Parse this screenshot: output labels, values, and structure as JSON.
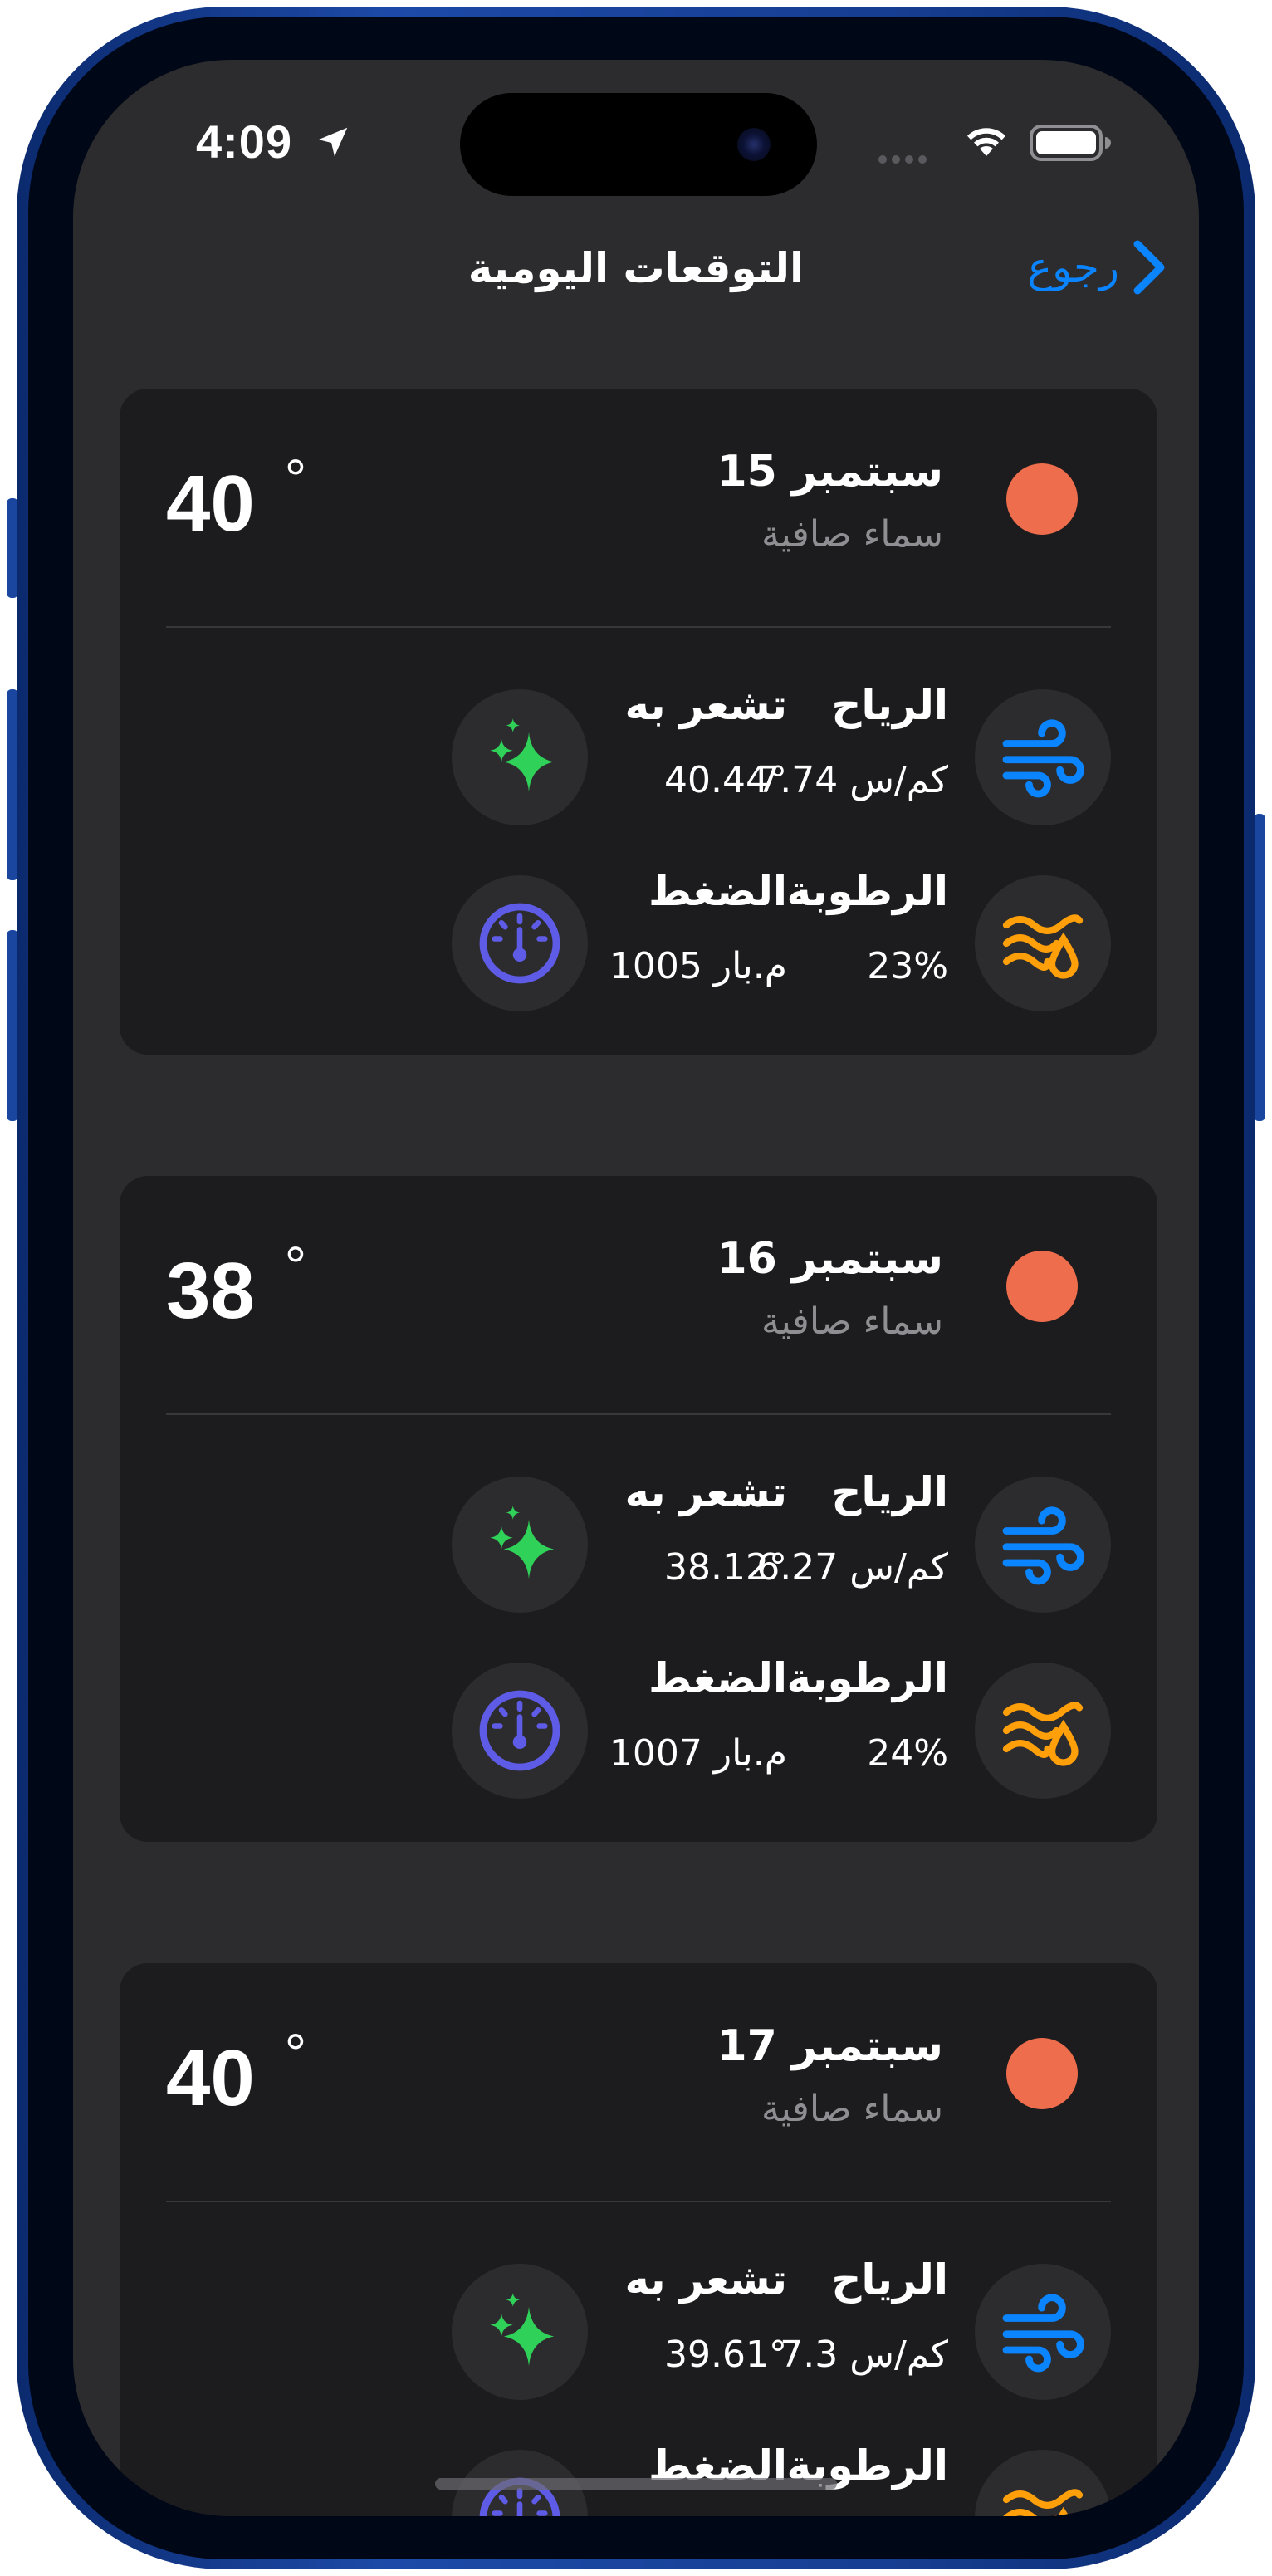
{
  "status_bar": {
    "time": "4:09",
    "location_icon": "location-arrow-icon",
    "wifi_icon": "wifi-icon",
    "battery_icon": "battery-icon"
  },
  "nav": {
    "title": "التوقعات اليومية",
    "back_label": "رجوع",
    "back_icon": "chevron-right-icon",
    "accent": "#0a84ff"
  },
  "colors": {
    "sun": "#ee6d4c",
    "wind": "#0a84ff",
    "feels_like": "#30d158",
    "humidity": "#ff9f0a",
    "pressure": "#5e5ce6"
  },
  "days": [
    {
      "date": "سبتمبر 15",
      "condition": "سماء صافية",
      "temp": "40",
      "degree": "°",
      "wind_label": "الرياح",
      "wind_value": "7.74 كم/س",
      "feels_label": "تشعر به",
      "feels_value": "40.44°",
      "humidity_label": "الرطوبة",
      "humidity_value": "23%",
      "pressure_label": "الضغط",
      "pressure_value": "1005 م.بار"
    },
    {
      "date": "سبتمبر 16",
      "condition": "سماء صافية",
      "temp": "38",
      "degree": "°",
      "wind_label": "الرياح",
      "wind_value": "6.27 كم/س",
      "feels_label": "تشعر به",
      "feels_value": "38.12°",
      "humidity_label": "الرطوبة",
      "humidity_value": "24%",
      "pressure_label": "الضغط",
      "pressure_value": "1007 م.بار"
    },
    {
      "date": "سبتمبر 17",
      "condition": "سماء صافية",
      "temp": "40",
      "degree": "°",
      "wind_label": "الرياح",
      "wind_value": "7.3 كم/س",
      "feels_label": "تشعر به",
      "feels_value": "39.61°",
      "humidity_label": "الرطوبة",
      "humidity_value": "",
      "pressure_label": "الضغط",
      "pressure_value": ""
    }
  ]
}
